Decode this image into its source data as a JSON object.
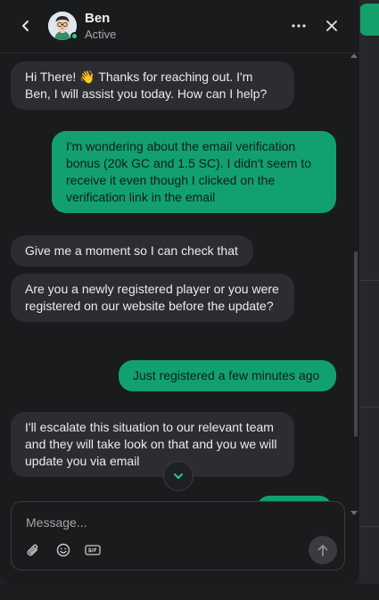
{
  "header": {
    "agent_name": "Ben",
    "agent_status": "Active"
  },
  "messages": [
    {
      "sender": "agent",
      "text": "Hi There! 👋 Thanks for reaching out. I'm Ben, I will assist you today. How can I help?"
    },
    {
      "sender": "user",
      "text": "I'm wondering about the email verification bonus (20k GC and 1.5 SC). I didn't seem to receive it even though I clicked on the verification link in the email"
    },
    {
      "sender": "agent",
      "text": "Give me a moment so I can check that"
    },
    {
      "sender": "agent",
      "text": "Are you a newly registered player or you were registered on our website before the update?"
    },
    {
      "sender": "user",
      "text": "Just registered a few minutes ago"
    },
    {
      "sender": "agent",
      "text": "I'll escalate this situation to our relevant team and they will take look on that and you we will update you via email"
    }
  ],
  "composer": {
    "placeholder": "Message..."
  },
  "icons": {
    "back": "chevron-left-icon",
    "more": "more-horizontal-icon",
    "close": "close-icon",
    "jump": "chevron-down-icon",
    "attach": "paperclip-icon",
    "emoji": "smiley-icon",
    "gif": "gif-icon",
    "send": "arrow-up-icon"
  },
  "colors": {
    "user_bubble": "#13a070",
    "agent_bubble": "#2c2d31",
    "panel_bg": "#1a1b1d",
    "online": "#2ccf86"
  }
}
